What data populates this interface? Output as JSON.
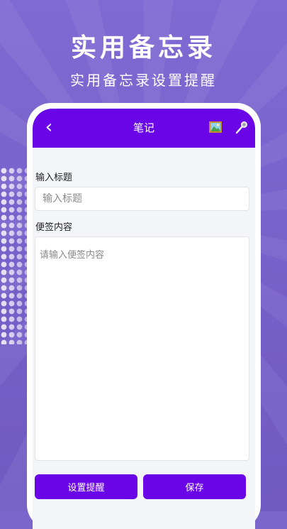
{
  "promo": {
    "title": "实用备忘录",
    "subtitle": "实用备忘录设置提醒"
  },
  "nav": {
    "back_glyph": "‹",
    "title": "笔记"
  },
  "form": {
    "title_label": "输入标题",
    "title_placeholder": "输入标题",
    "title_value": "",
    "content_label": "便签内容",
    "content_placeholder": "请输入便签内容",
    "content_value": ""
  },
  "buttons": {
    "reminder_label": "设置提醒",
    "save_label": "保存"
  },
  "colors": {
    "accent": "#6a05e8",
    "background": "#7b66cc"
  },
  "icons": [
    "back-chevron-icon",
    "image-icon",
    "microphone-icon"
  ]
}
